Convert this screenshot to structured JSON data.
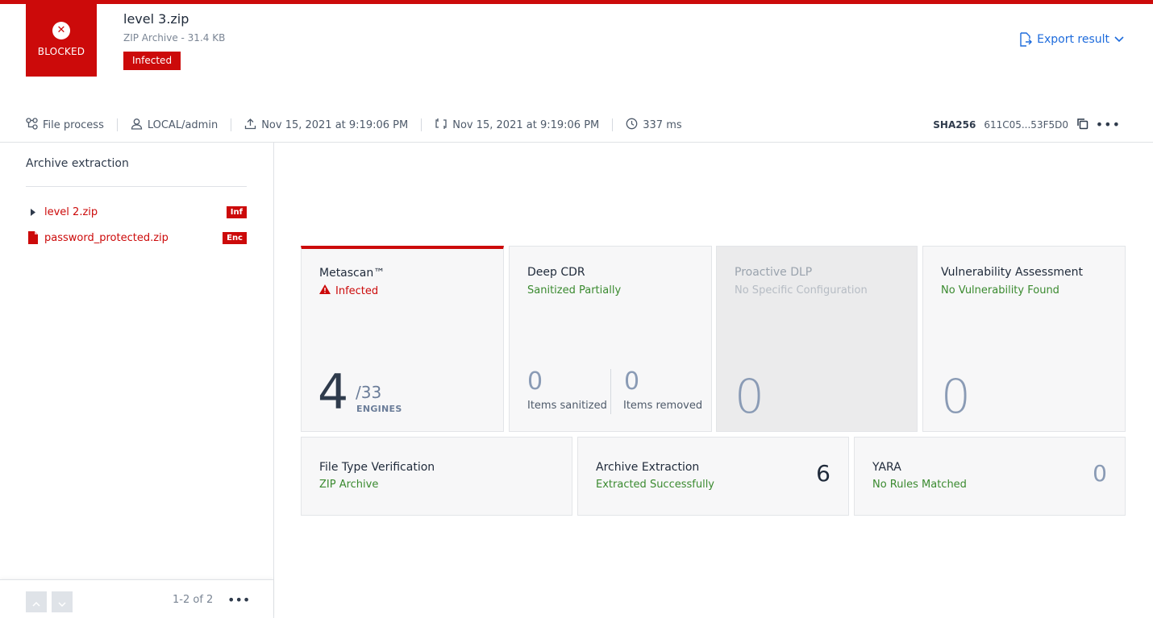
{
  "header": {
    "status_label": "BLOCKED",
    "status_icon": "x-circle-icon",
    "file_name": "level 3.zip",
    "file_info": "ZIP Archive - 31.4 KB",
    "verdict_tag": "Infected",
    "export_label": "Export result",
    "accent_color": "#cc0a0a",
    "link_color": "#1d6bdc"
  },
  "meta": {
    "process": "File process",
    "user": "LOCAL/admin",
    "uploaded": "Nov 15, 2021 at 9:19:06 PM",
    "processed": "Nov 15, 2021 at 9:19:06 PM",
    "duration": "337 ms",
    "sha_key": "SHA256",
    "sha_value": "611C05...53F5D0"
  },
  "sidebar": {
    "title": "Archive extraction",
    "items": [
      {
        "name": "level 2.zip",
        "badge": "Inf",
        "icon": "caret-right-icon"
      },
      {
        "name": "password_protected.zip",
        "badge": "Enc",
        "icon": "file-icon"
      }
    ],
    "pagination": "1-2 of 2"
  },
  "cards": {
    "metascan": {
      "title": "Metascan™",
      "status": "Infected",
      "detected": "4",
      "total": "/33",
      "unit": "ENGINES"
    },
    "cdr": {
      "title": "Deep CDR",
      "status": "Sanitized Partially",
      "sanitized_count": "0",
      "sanitized_label": "Items sanitized",
      "removed_count": "0",
      "removed_label": "Items removed"
    },
    "dlp": {
      "title": "Proactive DLP",
      "status": "No Specific Configuration",
      "count": "0"
    },
    "vuln": {
      "title": "Vulnerability Assessment",
      "status": "No Vulnerability Found",
      "count": "0"
    },
    "ftv": {
      "title": "File Type Verification",
      "status": "ZIP Archive"
    },
    "archive": {
      "title": "Archive Extraction",
      "status": "Extracted Successfully",
      "count": "6"
    },
    "yara": {
      "title": "YARA",
      "status": "No Rules Matched",
      "count": "0"
    }
  }
}
